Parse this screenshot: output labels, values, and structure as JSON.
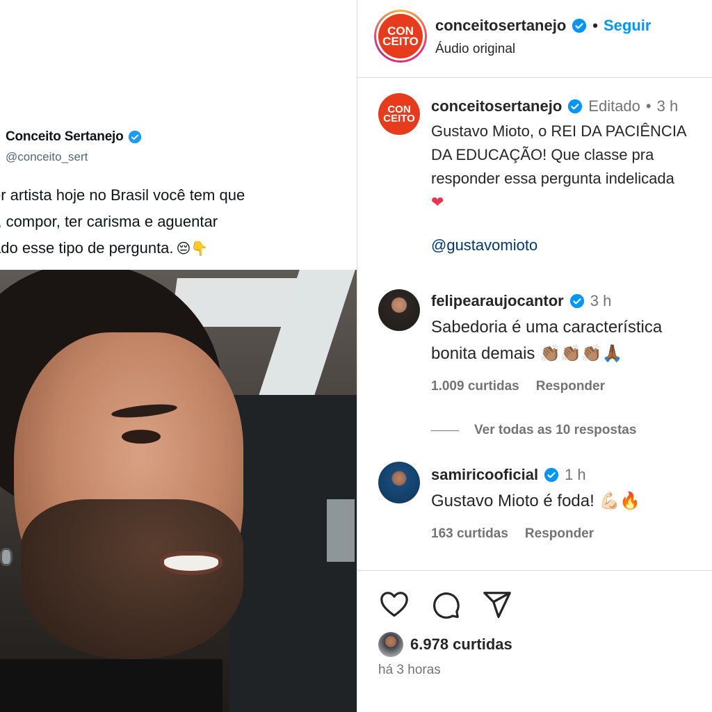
{
  "tweet": {
    "name": "Conceito Sertanejo",
    "handle": "@conceito_sert",
    "text": "ser artista hoje no Brasil você tem que\nar, compor, ter carisma e aguentar\ncado esse tipo de pergunta.",
    "emojis": "😔👇"
  },
  "header": {
    "avatar_text_top": "CON",
    "avatar_text_bottom": "CEITO",
    "username": "conceitosertanejo",
    "separator": "•",
    "follow_label": "Seguir",
    "audio": "Áudio original"
  },
  "caption": {
    "username": "conceitosertanejo",
    "edited": "Editado",
    "separator": "•",
    "time": "3 h",
    "text": "Gustavo Mioto, o REI DA PACIÊNCIA\nDA EDUCAÇÃO! Que classe pra\nresponder essa pergunta indelicada",
    "emoji": "❤",
    "mention": "@gustavomioto"
  },
  "comments": [
    {
      "username": "felipearaujocantor",
      "time": "3 h",
      "text": "Sabedoria é uma característica\nbonita demais 👏🏽👏🏽👏🏽🙏🏾",
      "likes": "1.009 curtidas",
      "reply_label": "Responder"
    },
    {
      "username": "samiricooficial",
      "time": "1 h",
      "text": "Gustavo Mioto é foda! 💪🏻🔥",
      "likes": "163 curtidas",
      "reply_label": "Responder"
    }
  ],
  "view_replies": "Ver todas as 10 respostas",
  "footer": {
    "likes": "6.978 curtidas",
    "time_ago": "há 3 horas"
  },
  "colors": {
    "accent_blue": "#0095f6",
    "mention_blue": "#00376b",
    "verified_blue": "#0095f6",
    "brand_red": "#e63b1d"
  },
  "icons": [
    "verified-icon",
    "heart-icon",
    "comment-icon",
    "share-icon"
  ]
}
